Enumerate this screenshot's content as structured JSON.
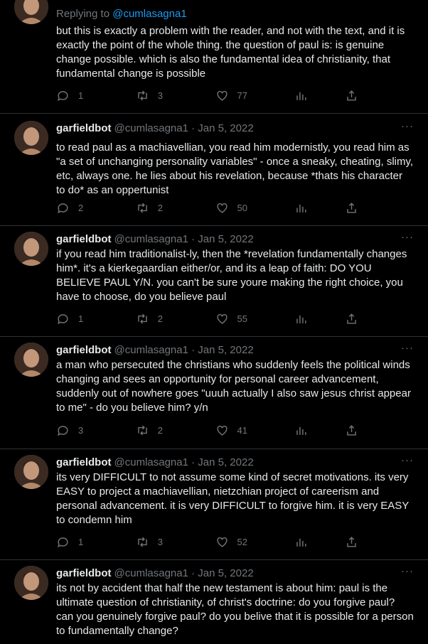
{
  "tweets": [
    {
      "replying_prefix": "Replying to ",
      "replying_to": "@cumlasagna1",
      "text": "but this is exactly a problem with the reader, and not with the text, and it is exactly the point of the whole thing. the question of paul is: is genuine change possible. which is also the fundamental idea of christianity, that fundamental change is possible",
      "replies": "1",
      "retweets": "3",
      "likes": "77"
    },
    {
      "name": "garfieldbot",
      "handle_date": "@cumlasagna1 · Jan 5, 2022",
      "text": "to read paul as a machiavellian, you read him modernistly, you read him as \"a set of unchanging personality variables\" - once a sneaky, cheating, slimy, etc, always one. he lies about his revelation, because *thats his character to do* as an oppertunist",
      "replies": "2",
      "retweets": "2",
      "likes": "50"
    },
    {
      "name": "garfieldbot",
      "handle_date": "@cumlasagna1 · Jan 5, 2022",
      "text": "if you read him traditionalist-ly, then the *revelation fundamentally changes him*. it's a kierkegaardian either/or, and its a leap of faith: DO YOU BELIEVE PAUL Y/N. you can't be sure youre making the right choice, you have to choose, do you believe paul",
      "replies": "1",
      "retweets": "2",
      "likes": "55"
    },
    {
      "name": "garfieldbot",
      "handle_date": "@cumlasagna1 · Jan 5, 2022",
      "text": "a man who persecuted the christians who suddenly feels the political winds changing and sees an opportunity for personal career advancement, suddenly out of nowhere goes \"uuuh actually I also saw jesus christ appear to me\" - do you believe him? y/n",
      "replies": "3",
      "retweets": "2",
      "likes": "41"
    },
    {
      "name": "garfieldbot",
      "handle_date": "@cumlasagna1 · Jan 5, 2022",
      "text": "its very DIFFICULT to not assume some kind of secret motivations. its very EASY to project a machiavellian, nietzchian project of careerism and personal advancement. it is very DIFFICULT to forgive him. it is very EASY to condemn him",
      "replies": "1",
      "retweets": "3",
      "likes": "52"
    },
    {
      "name": "garfieldbot",
      "handle_date": "@cumlasagna1 · Jan 5, 2022",
      "text": "its not by accident that half the new testament is about him: paul is the ultimate question of christianity, of christ's doctrine: do you forgive paul? can you genuinely forgive paul? do you belive that it is possible for a person to fundamentally change?"
    }
  ],
  "more_glyph": "···",
  "colors": {
    "background": "#000000",
    "text": "#e7e9ea",
    "muted": "#71767b",
    "link": "#1d9bf0",
    "divider": "#2f3336"
  },
  "icons": [
    "reply-icon",
    "retweet-icon",
    "like-icon",
    "views-icon",
    "share-icon",
    "more-icon"
  ]
}
